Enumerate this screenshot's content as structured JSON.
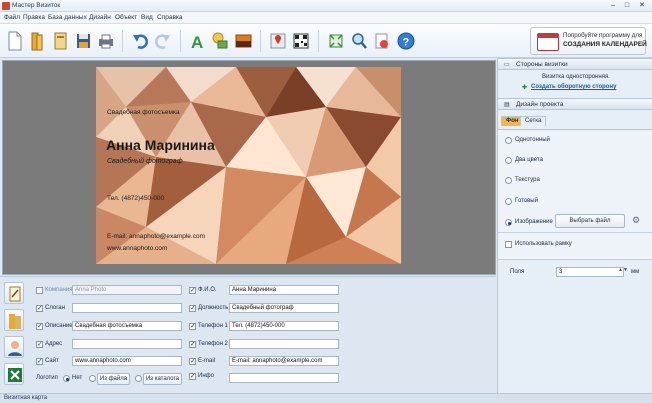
{
  "window": {
    "title": "Мастер Визиток"
  },
  "menu": [
    "Файл",
    "Правка",
    "База данных",
    "Дизайн",
    "Объект",
    "Вид",
    "Справка"
  ],
  "promo": {
    "line1": "Попробуйте программу для",
    "line2": "СОЗДАНИЯ КАЛЕНДАРЕЙ"
  },
  "card": {
    "tagline": "Свадебная фотосъемка",
    "name": "Анна Маринина",
    "role": "Свадебный фотограф",
    "phone": "Тел. (4872)450-000",
    "email": "E-mail: annaphoto@example.com",
    "site": "www.annaphoto.com"
  },
  "form": {
    "company": {
      "label": "Компания",
      "value": "Anna Photo",
      "checked": false
    },
    "slogan": {
      "label": "Слоган",
      "value": "",
      "checked": true
    },
    "description": {
      "label": "Описание",
      "value": "Свадебная фотосъемка",
      "checked": true
    },
    "address": {
      "label": "Адрес",
      "value": "",
      "checked": true
    },
    "site": {
      "label": "Сайт",
      "value": "www.annaphoto.com",
      "checked": true
    },
    "logo": {
      "label": "Логотип",
      "opt_none": "Нет",
      "opt_file": "Из файла",
      "opt_catalog": "Из каталога"
    },
    "fio": {
      "label": "Ф.И.О.",
      "value": "Анна Маринина",
      "checked": true
    },
    "position": {
      "label": "Должность",
      "value": "Свадебный фотограф",
      "checked": true
    },
    "phone1": {
      "label": "Телефон 1",
      "value": "Тел. (4872)450-000",
      "checked": true
    },
    "phone2": {
      "label": "Телефон 2",
      "value": "",
      "checked": true
    },
    "email": {
      "label": "E-mail",
      "value": "E-mail: annaphoto@example.com",
      "checked": true
    },
    "info": {
      "label": "Инфо",
      "value": "",
      "checked": true
    }
  },
  "panel": {
    "sides_header": "Стороны визитки",
    "sides_text": "Визитка односторонняя.",
    "sides_link": "Создать оборотную сторону",
    "design_header": "Дизайн проекта",
    "tab_bg": "Фон",
    "tab_grid": "Сетка",
    "bg_solid": "Однотонный",
    "bg_two": "Два цвета",
    "bg_texture": "Текстура",
    "bg_ready": "Готовый",
    "bg_image": "Изображение",
    "choose_file": "Выбрать файл",
    "use_frame": "Использовать рамку",
    "margins_label": "Поля",
    "margins_value": "3",
    "margins_unit": "мм"
  },
  "status": "Визитная карта",
  "colors": {
    "accent_tab": "#f6b545",
    "link": "#1a5aa8",
    "panel_bg": "#e6eef8"
  }
}
